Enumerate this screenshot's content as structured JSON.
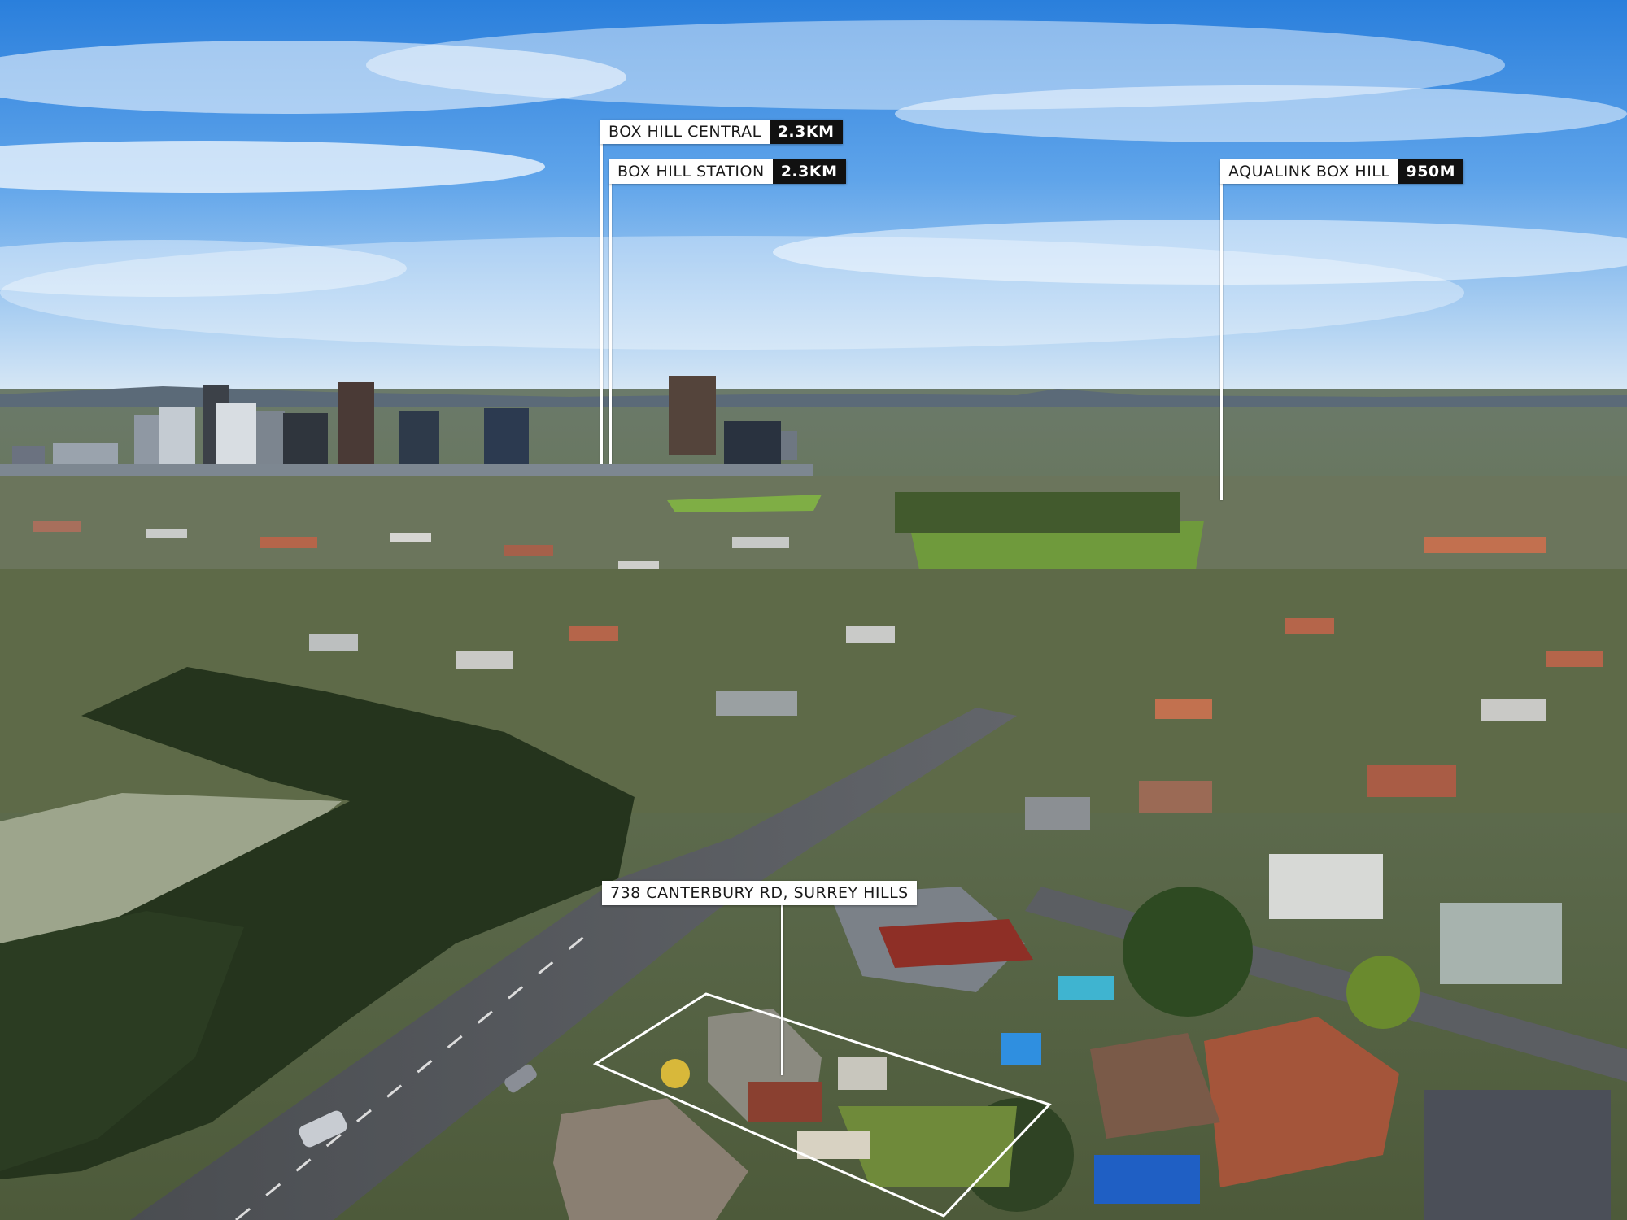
{
  "callouts": [
    {
      "name": "BOX HILL CENTRAL",
      "distance": "2.3KM"
    },
    {
      "name": "BOX HILL STATION",
      "distance": "2.3KM"
    },
    {
      "name": "AQUALINK BOX HILL",
      "distance": "950M"
    }
  ],
  "property": {
    "address": "738 CANTERBURY RD, SURREY HILLS"
  },
  "colors": {
    "sky_top": "#2f86e0",
    "sky_horizon": "#cfe3f5",
    "foliage": "#3c5a2c",
    "roofs": "#b5654a",
    "road": "#55585c",
    "label_bg": "#ffffff",
    "distance_bg": "#111111"
  }
}
